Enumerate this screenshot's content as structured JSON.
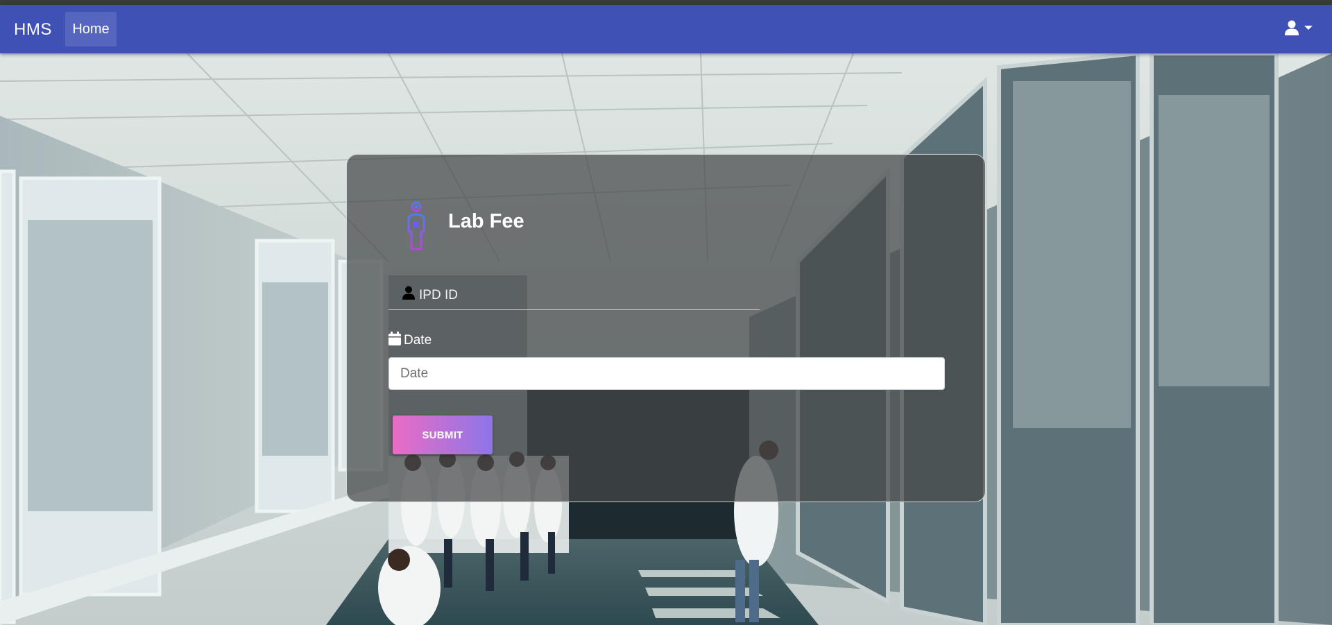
{
  "navbar": {
    "brand": "HMS",
    "home_label": "Home",
    "user_icon": "user-icon",
    "dropdown_icon": "caret-down-icon",
    "bg_color": "#3f51b5"
  },
  "background": {
    "description_icon": "hospital-corridor-photo"
  },
  "form": {
    "icon": "human-body-icon",
    "title": "Lab Fee",
    "ipd_placeholder": "IPD ID",
    "ipd_icon": "user-icon",
    "date_label": "Date",
    "date_icon": "calendar-icon",
    "date_placeholder": "Date",
    "submit_label": "SUBMIT",
    "submit_gradient": [
      "#ea6cc4",
      "#8d75ea"
    ]
  }
}
